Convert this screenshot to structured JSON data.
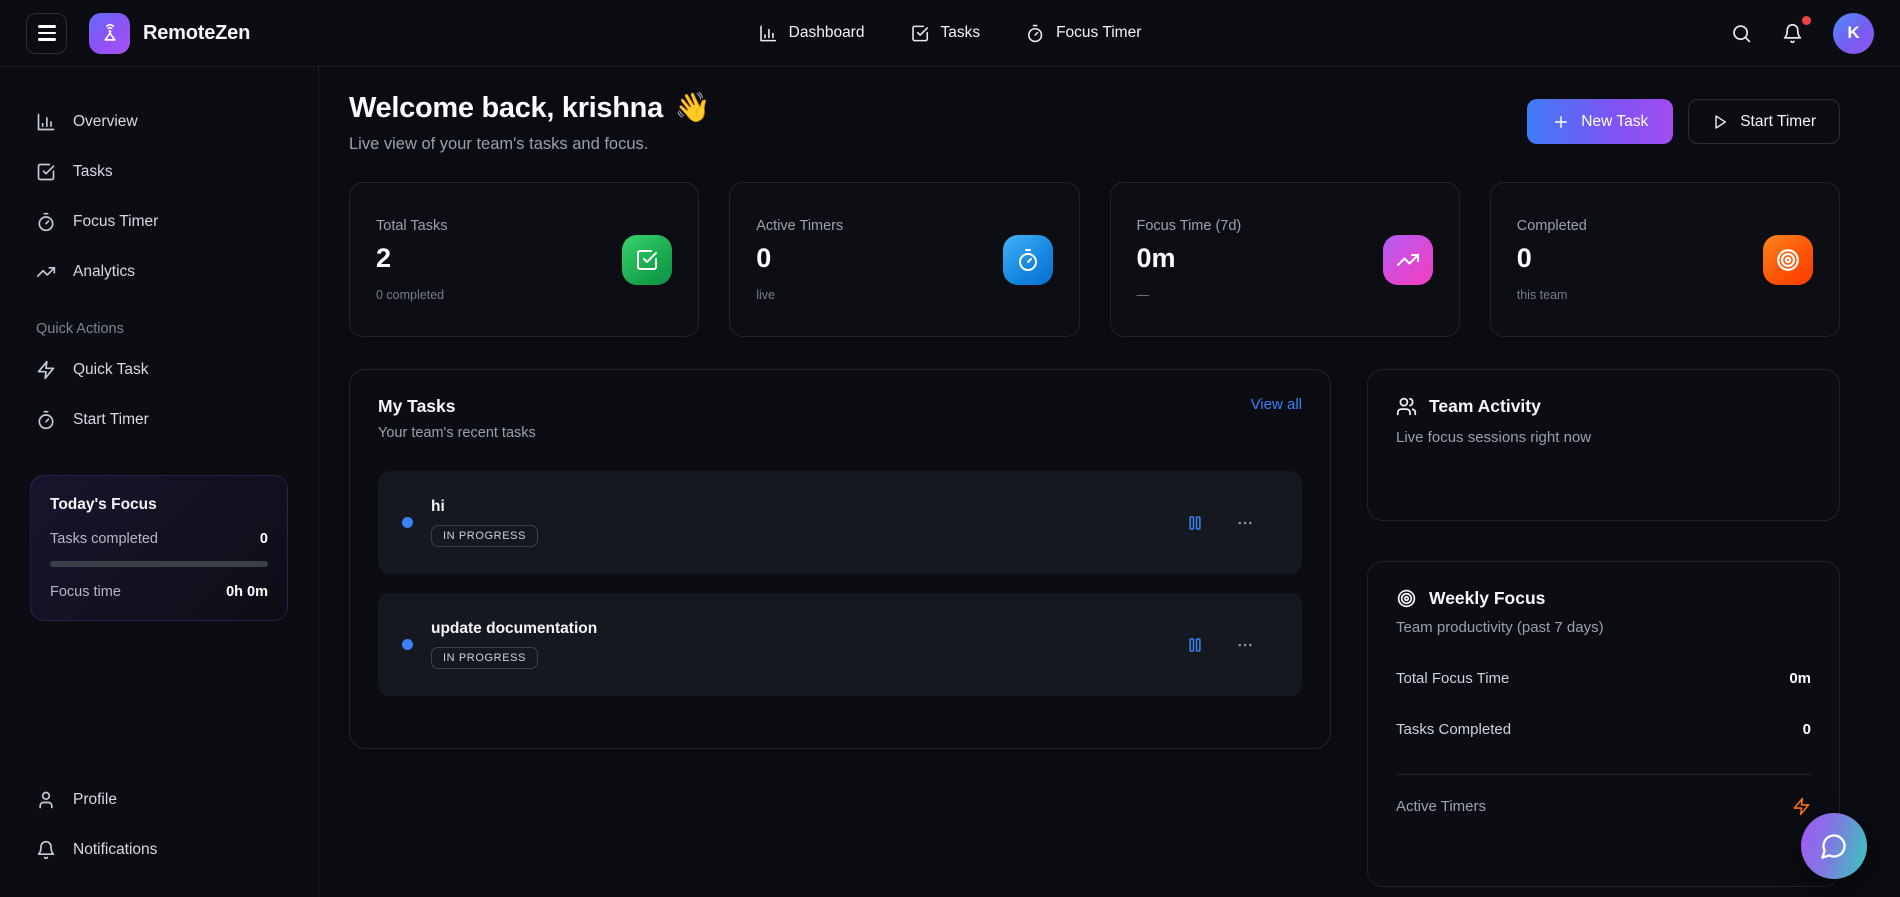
{
  "topbar": {
    "brand": "RemoteZen",
    "nav": [
      {
        "label": "Dashboard",
        "icon": "bar-chart-icon"
      },
      {
        "label": "Tasks",
        "icon": "check-square-icon"
      },
      {
        "label": "Focus Timer",
        "icon": "timer-icon"
      }
    ],
    "search_icon": "search-icon",
    "notifications_icon": "bell-icon",
    "has_unread_notifications": true,
    "avatar_initial": "K"
  },
  "sidebar": {
    "items": [
      {
        "label": "Overview",
        "icon": "bar-chart-icon"
      },
      {
        "label": "Tasks",
        "icon": "check-square-icon"
      },
      {
        "label": "Focus Timer",
        "icon": "timer-icon"
      },
      {
        "label": "Analytics",
        "icon": "trending-up-icon"
      }
    ],
    "quick_actions_label": "Quick Actions",
    "quick_actions": [
      {
        "label": "Quick Task",
        "icon": "zap-icon"
      },
      {
        "label": "Start Timer",
        "icon": "timer-icon"
      }
    ],
    "today_focus": {
      "title": "Today's Focus",
      "tasks_completed_label": "Tasks completed",
      "tasks_completed_value": "0",
      "progress_percent": 0,
      "focus_time_label": "Focus time",
      "focus_time_value": "0h 0m"
    },
    "bottom_items": [
      {
        "label": "Profile",
        "icon": "user-icon"
      },
      {
        "label": "Notifications",
        "icon": "bell-icon"
      }
    ]
  },
  "header": {
    "title": "Welcome back, krishna",
    "wave_emoji": "👋",
    "subtitle": "Live view of your team's tasks and focus.",
    "new_task_label": "New Task",
    "start_timer_label": "Start Timer"
  },
  "stats": [
    {
      "label": "Total Tasks",
      "value": "2",
      "sub": "0 completed",
      "icon": "check-square-icon",
      "icon_gradient": [
        "#37d36c",
        "#0e9048"
      ]
    },
    {
      "label": "Active Timers",
      "value": "0",
      "sub": "live",
      "icon": "timer-icon",
      "icon_gradient": [
        "#43b2f6",
        "#0b6fd0"
      ]
    },
    {
      "label": "Focus Time (7d)",
      "value": "0m",
      "sub": "—",
      "icon": "trending-up-icon",
      "icon_gradient": [
        "#b05ef6",
        "#f03fbd"
      ]
    },
    {
      "label": "Completed",
      "value": "0",
      "sub": "this team",
      "icon": "target-icon",
      "icon_gradient": [
        "#fb851f",
        "#ff3a00"
      ]
    }
  ],
  "my_tasks": {
    "title": "My Tasks",
    "subtitle": "Your team's recent tasks",
    "view_all_label": "View all",
    "tasks": [
      {
        "title": "hi",
        "status": "IN PROGRESS",
        "dot_color": "#3b82f6"
      },
      {
        "title": "update documentation",
        "status": "IN PROGRESS",
        "dot_color": "#3b82f6"
      }
    ]
  },
  "team_activity": {
    "title": "Team Activity",
    "subtitle": "Live focus sessions right now",
    "icon": "users-icon"
  },
  "weekly_focus": {
    "title": "Weekly Focus",
    "subtitle": "Team productivity (past 7 days)",
    "icon": "target-icon",
    "rows": [
      {
        "label": "Total Focus Time",
        "value": "0m"
      },
      {
        "label": "Tasks Completed",
        "value": "0"
      }
    ],
    "active_timers_label": "Active Timers",
    "active_timers_icon": "zap-icon",
    "active_timers_icon_color": "#f97316"
  },
  "fab": {
    "icon": "chat-bubble-icon"
  },
  "colors": {
    "page_bg": "#0a0c11",
    "card_bg": "#0c0e13",
    "accent_blue": "#3b82f6",
    "accent_purple": "#a855f7",
    "notification_red": "#ef4444",
    "brand_gradient": [
      "#5f6cfb",
      "#a855f7"
    ]
  }
}
